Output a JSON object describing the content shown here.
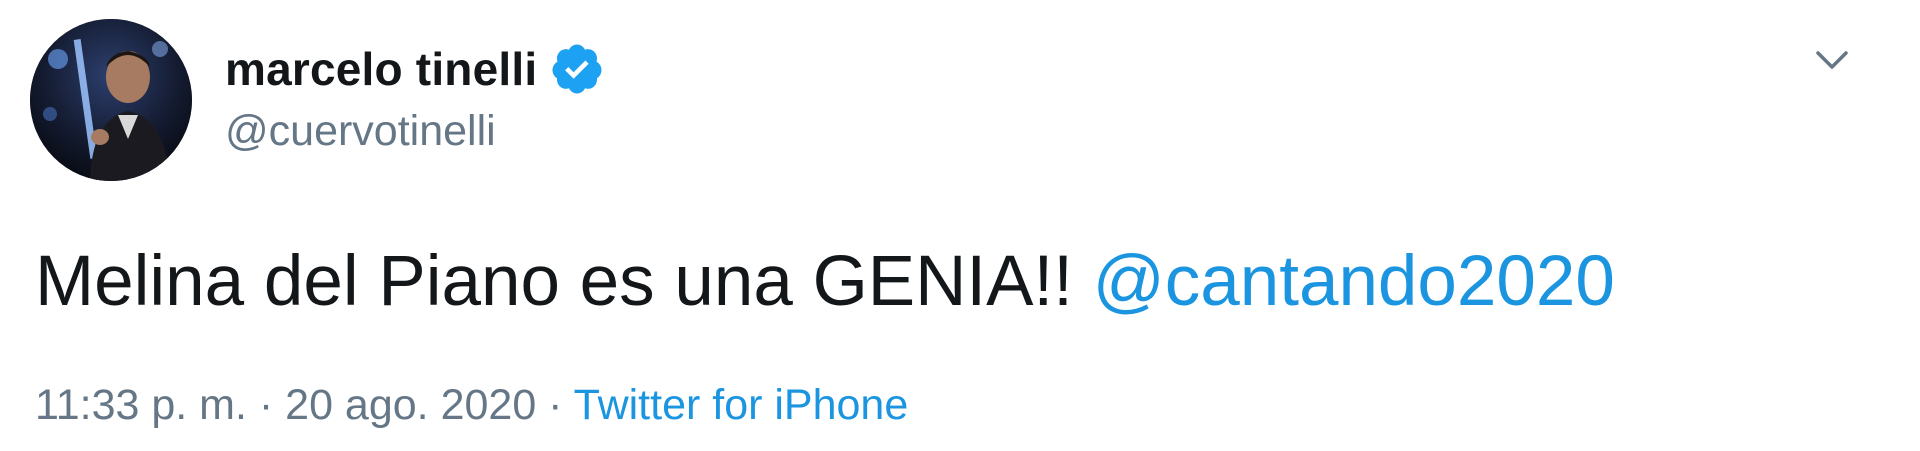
{
  "author": {
    "display_name": "marcelo tinelli",
    "handle": "@cuervotinelli",
    "verified": true
  },
  "tweet": {
    "text": "Melina del Piano es una GENIA!! ",
    "mention": "@cantando2020"
  },
  "meta": {
    "time": "11:33 p. m.",
    "separator": " · ",
    "date": "20 ago. 2020",
    "separator2": " · ",
    "source": "Twitter for iPhone"
  },
  "icons": {
    "verified": "verified-badge-icon",
    "menu": "chevron-down-icon"
  },
  "colors": {
    "text": "#14171a",
    "secondary": "#657786",
    "link": "#1b95e0",
    "verified": "#1da1f2"
  }
}
